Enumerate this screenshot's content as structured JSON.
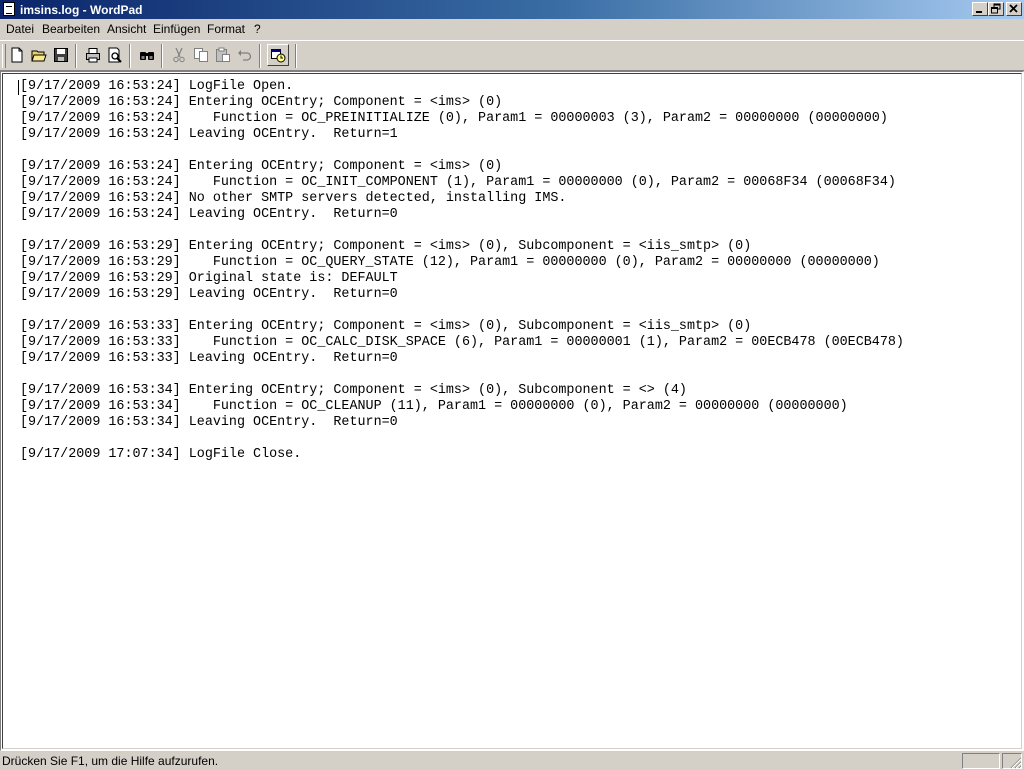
{
  "window": {
    "title": "imsins.log - WordPad",
    "controls": [
      "minimize",
      "restore",
      "close"
    ]
  },
  "menu": {
    "items": [
      "Datei",
      "Bearbeiten",
      "Ansicht",
      "Einfügen",
      "Format",
      "?"
    ]
  },
  "toolbar": {
    "buttons": [
      "new-document-icon",
      "open-folder-icon",
      "save-icon",
      "print-icon",
      "print-preview-icon",
      "find-icon",
      "cut-icon",
      "copy-icon",
      "paste-icon",
      "undo-icon",
      "insert-date-time-icon"
    ]
  },
  "document": {
    "lines": [
      "[9/17/2009 16:53:24] LogFile Open.",
      "[9/17/2009 16:53:24] Entering OCEntry; Component = <ims> (0)",
      "[9/17/2009 16:53:24]    Function = OC_PREINITIALIZE (0), Param1 = 00000003 (3), Param2 = 00000000 (00000000)",
      "[9/17/2009 16:53:24] Leaving OCEntry.  Return=1",
      "",
      "[9/17/2009 16:53:24] Entering OCEntry; Component = <ims> (0)",
      "[9/17/2009 16:53:24]    Function = OC_INIT_COMPONENT (1), Param1 = 00000000 (0), Param2 = 00068F34 (00068F34)",
      "[9/17/2009 16:53:24] No other SMTP servers detected, installing IMS.",
      "[9/17/2009 16:53:24] Leaving OCEntry.  Return=0",
      "",
      "[9/17/2009 16:53:29] Entering OCEntry; Component = <ims> (0), Subcomponent = <iis_smtp> (0)",
      "[9/17/2009 16:53:29]    Function = OC_QUERY_STATE (12), Param1 = 00000000 (0), Param2 = 00000000 (00000000)",
      "[9/17/2009 16:53:29] Original state is: DEFAULT",
      "[9/17/2009 16:53:29] Leaving OCEntry.  Return=0",
      "",
      "[9/17/2009 16:53:33] Entering OCEntry; Component = <ims> (0), Subcomponent = <iis_smtp> (0)",
      "[9/17/2009 16:53:33]    Function = OC_CALC_DISK_SPACE (6), Param1 = 00000001 (1), Param2 = 00ECB478 (00ECB478)",
      "[9/17/2009 16:53:33] Leaving OCEntry.  Return=0",
      "",
      "[9/17/2009 16:53:34] Entering OCEntry; Component = <ims> (0), Subcomponent = <> (4)",
      "[9/17/2009 16:53:34]    Function = OC_CLEANUP (11), Param1 = 00000000 (0), Param2 = 00000000 (00000000)",
      "[9/17/2009 16:53:34] Leaving OCEntry.  Return=0",
      "",
      "[9/17/2009 17:07:34] LogFile Close."
    ]
  },
  "statusbar": {
    "text": "Drücken Sie F1, um die Hilfe aufzurufen."
  }
}
